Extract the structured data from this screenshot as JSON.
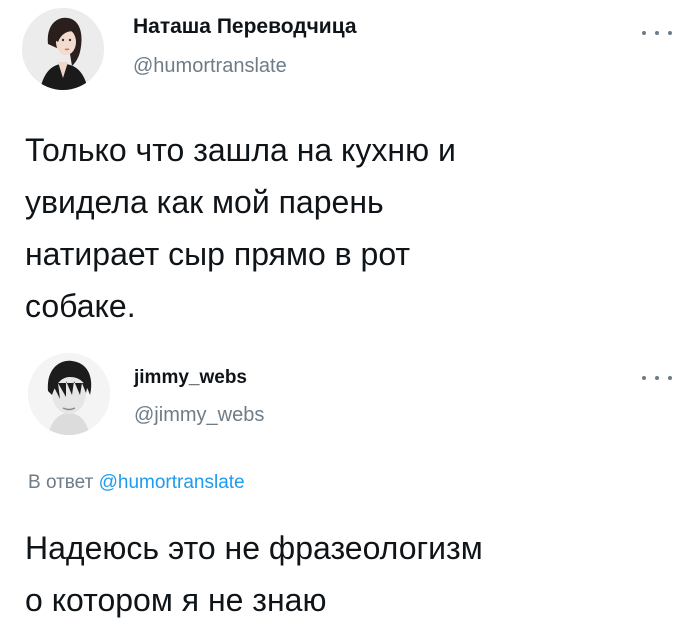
{
  "tweets": [
    {
      "display_name": "Наташа Переводчица",
      "handle": "@humortranslate",
      "text": "Только что зашла на кухню и\nувидела как мой парень\nнатирает сыр прямо в рот\nсобаке.",
      "avatar_icon": "profile-photo-woman"
    },
    {
      "display_name": "jimmy_webs",
      "handle": "@jimmy_webs",
      "reply_prefix": "В ответ",
      "reply_mention": "@humortranslate",
      "text": "Надеюсь это не фразеологизм\nо котором я не знаю",
      "avatar_icon": "profile-photo-man"
    }
  ],
  "colors": {
    "text_primary": "#0f1419",
    "text_secondary": "#6e7c87",
    "link": "#1d9bf0",
    "background": "#ffffff"
  }
}
